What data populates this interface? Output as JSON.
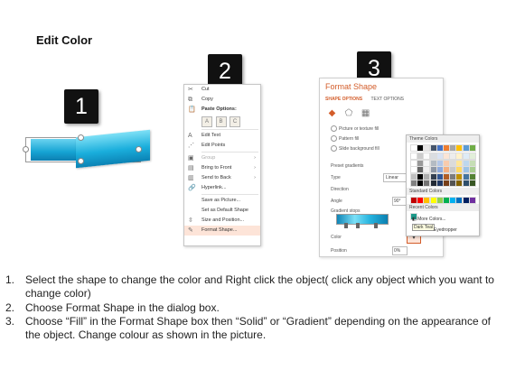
{
  "title": "Edit Color",
  "badges": [
    "1",
    "2",
    "3"
  ],
  "context_menu": {
    "items": [
      {
        "label": "Cut",
        "icon": "scissors-icon",
        "glyph": "✂"
      },
      {
        "label": "Copy",
        "icon": "copy-icon",
        "glyph": "⧉"
      },
      {
        "label": "Paste Options:",
        "icon": "paste-icon",
        "glyph": "📋"
      }
    ],
    "paste_icons": [
      "A",
      "B",
      "C"
    ],
    "items2": [
      {
        "label": "Edit Text",
        "icon": "edit-text-icon",
        "glyph": "A"
      },
      {
        "label": "Edit Points",
        "icon": "edit-points-icon",
        "glyph": "⋰"
      }
    ],
    "items3": [
      {
        "label": "Group",
        "icon": "group-icon",
        "glyph": "▣",
        "arrow": "›",
        "dim": true
      },
      {
        "label": "Bring to Front",
        "icon": "bring-front-icon",
        "glyph": "▤",
        "arrow": "›"
      },
      {
        "label": "Send to Back",
        "icon": "send-back-icon",
        "glyph": "▥",
        "arrow": "›"
      },
      {
        "label": "Hyperlink...",
        "icon": "hyperlink-icon",
        "glyph": "🔗"
      }
    ],
    "items4": [
      {
        "label": "Save as Picture...",
        "icon": "",
        "glyph": ""
      },
      {
        "label": "Set as Default Shape",
        "icon": "",
        "glyph": ""
      },
      {
        "label": "Size and Position...",
        "icon": "size-position-icon",
        "glyph": "⇳"
      },
      {
        "label": "Format Shape...",
        "icon": "format-shape-icon",
        "glyph": "✎"
      }
    ]
  },
  "format_shape": {
    "title": "Format Shape",
    "tabs": [
      "SHAPE OPTIONS",
      "TEXT OPTIONS"
    ],
    "fill_options": [
      "Picture or texture fill",
      "Pattern fill",
      "Slide background fill"
    ],
    "preset_label": "Preset gradients",
    "type_label": "Type",
    "type_value": "Linear",
    "direction_label": "Direction",
    "angle_label": "Angle",
    "angle_value": "90°",
    "stops_label": "Gradient stops",
    "color_label": "Color",
    "position_label": "Position",
    "position_value": "0%"
  },
  "color_picker": {
    "theme_label": "Theme Colors",
    "standard_label": "Standard Colors",
    "recent_label": "Recent Colors",
    "more_colors": "More Colors...",
    "eyedropper": "Eyedropper",
    "tooltip": "Dark Teal",
    "theme_top": [
      "#ffffff",
      "#000000",
      "#e7e6e6",
      "#44546a",
      "#4472c4",
      "#ed7d31",
      "#a5a5a5",
      "#ffc000",
      "#5b9bd5",
      "#70ad47"
    ],
    "standard": [
      "#c00000",
      "#ff0000",
      "#ffc000",
      "#ffff00",
      "#92d050",
      "#00b050",
      "#00b0f0",
      "#0070c0",
      "#002060",
      "#7030a0"
    ],
    "recent": [
      "#1b9a8a"
    ]
  },
  "steps": [
    {
      "n": "1.",
      "text": "Select the shape to change the color and Right click the object( click any object which you want to change color)"
    },
    {
      "n": "2.",
      "text": "Choose Format Shape in the dialog box."
    },
    {
      "n": "3.",
      "text": "Choose “Fill” in the Format Shape box then “Solid” or “Gradient” depending on the appearance of the object. Change colour as shown in the picture."
    }
  ]
}
